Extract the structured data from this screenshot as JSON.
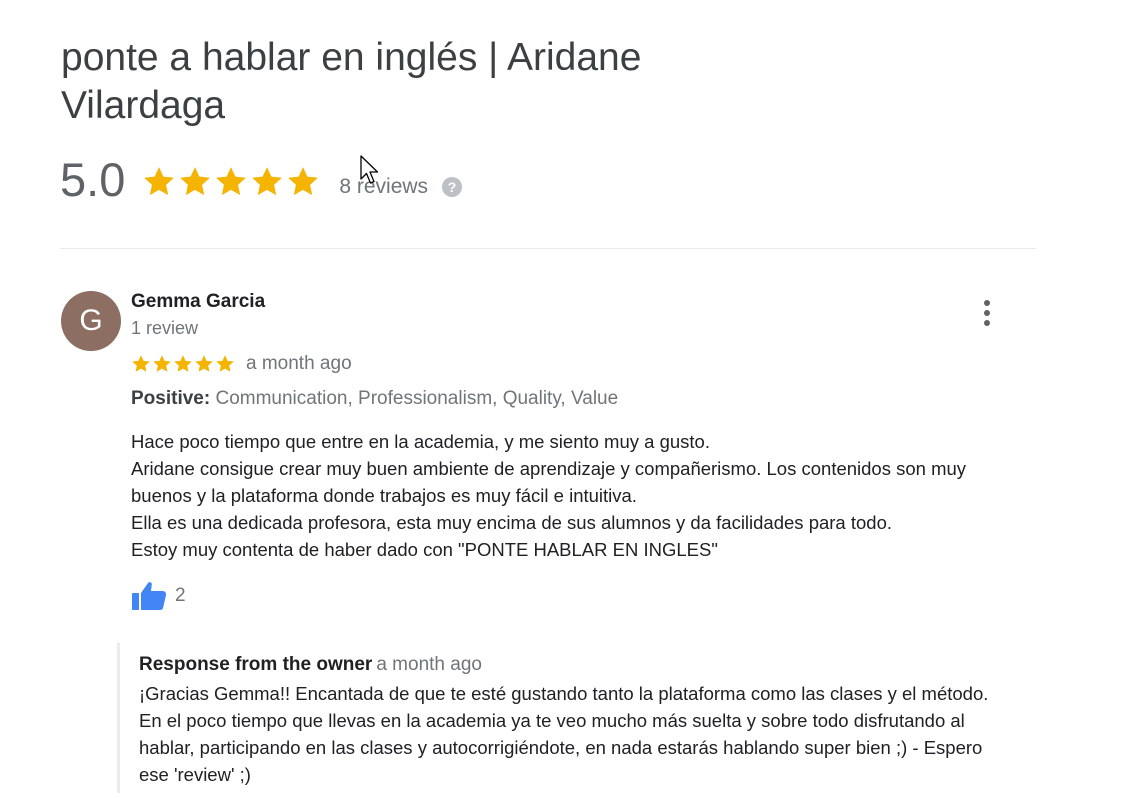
{
  "business": {
    "title": "ponte a hablar en inglés | Aridane Vilardaga"
  },
  "summary": {
    "score": "5.0",
    "stars": 5,
    "review_count": "8 reviews",
    "help_label": "?"
  },
  "colors": {
    "star": "#f4b400",
    "like": "#4285f4",
    "avatar_bg": "#8d6e63"
  },
  "review": {
    "avatar_letter": "G",
    "name": "Gemma Garcia",
    "reviewer_reviews": "1 review",
    "stars": 5,
    "date": "a month ago",
    "positive_label": "Positive:",
    "positive_values": "Communication, Professionalism, Quality, Value",
    "text_lines": [
      "Hace poco tiempo que entre en la academia, y me siento muy a gusto.",
      "Aridane consigue crear muy buen ambiente de aprendizaje y compañerismo. Los contenidos son muy",
      "buenos y la plataforma donde trabajos es muy fácil e intuitiva.",
      "Ella es una dedicada profesora, esta muy encima de sus alumnos y da facilidades para todo.",
      "Estoy muy contenta de haber dado con \"PONTE HABLAR EN INGLES\""
    ],
    "likes": "2"
  },
  "owner_response": {
    "label": "Response from the owner",
    "date": "a month ago",
    "text_lines": [
      "¡Gracias Gemma!! Encantada de que te esté gustando tanto la plataforma como las clases y el método.",
      "En el poco tiempo que llevas en la academia ya te veo mucho más suelta y sobre todo disfrutando al",
      "hablar, participando en las clases y autocorrigiéndote, en nada estarás hablando super bien ;) - Espero",
      "ese 'review' ;)"
    ]
  }
}
